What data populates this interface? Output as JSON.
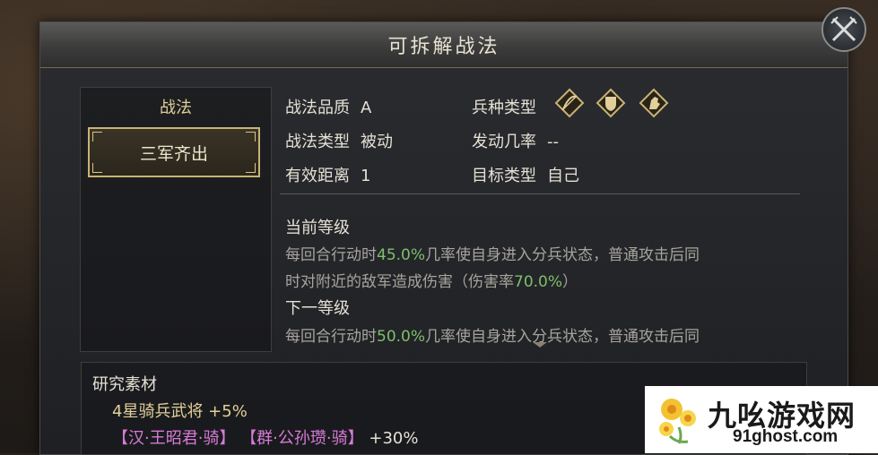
{
  "dialog": {
    "title": "可拆解战法"
  },
  "left_panel": {
    "header": "战法",
    "selected_skill": "三军齐出"
  },
  "info": {
    "quality_label": "战法品质",
    "quality_value": "A",
    "type_label": "战法类型",
    "type_value": "被动",
    "range_label": "有效距离",
    "range_value": "1",
    "troop_label": "兵种类型",
    "troop_icons": [
      "archer-icon",
      "shield-icon",
      "cavalry-icon"
    ],
    "chance_label": "发动几率",
    "chance_value": "--",
    "target_label": "目标类型",
    "target_value": "自己"
  },
  "current_level": {
    "title": "当前等级",
    "line1_a": "每回合行动时",
    "line1_rate": "45.0%",
    "line1_b": "几率使自身进入分兵状态，普通攻击后同",
    "line2_a": "时对附近的敌军造成伤害（伤害率",
    "line2_rate": "70.0%",
    "line2_b": "）"
  },
  "next_level": {
    "title": "下一等级",
    "line1_a": "每回合行动时",
    "line1_rate": "50.0%",
    "line1_b": "几率使自身进入分兵状态，普通攻击后同"
  },
  "research": {
    "title": "研究素材",
    "line1": "4星骑兵武将 +5%",
    "general1": "【汉·王昭君·骑】",
    "general2": "【群·公孙瓒·骑】",
    "bonus": "+30%"
  },
  "watermark": {
    "name": "九吆游戏网",
    "url": "91ghost.com"
  },
  "colors": {
    "gold": "#e2cf9a",
    "green": "#7fbf6a",
    "pink": "#d77bd8"
  }
}
